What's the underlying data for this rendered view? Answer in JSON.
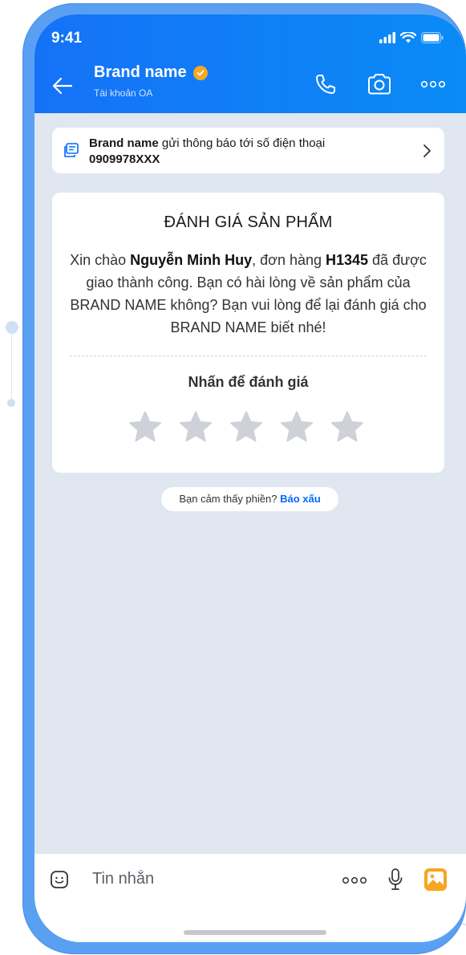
{
  "status_bar": {
    "time": "9:41"
  },
  "header": {
    "brand_name": "Brand name",
    "subtitle": "Tài khoản OA",
    "colors": {
      "gradient_start": "#1572f7",
      "gradient_end": "#0a8bf6",
      "verified": "#f6a823"
    }
  },
  "notice": {
    "brand": "Brand name",
    "text": " gửi thông báo tới số điện thoại",
    "phone": "0909978XXX"
  },
  "card": {
    "title": "ĐÁNH GIÁ SẢN PHẨM",
    "greeting": "Xin chào ",
    "customer_name": "Nguyễn Minh Huy",
    "order_prefix": ", đơn hàng ",
    "order_id": "H1345",
    "body_rest": " đã được giao thành công. Bạn có hài lòng về sản phẩm của BRAND NAME không? Bạn vui lòng để lại đánh giá cho BRAND NAME biết nhé!",
    "rate_label": "Nhấn để đánh giá",
    "rating": {
      "value": 0,
      "max": 5
    }
  },
  "report": {
    "text": "Bạn cảm thấy phiền? ",
    "link": "Báo xấu"
  },
  "input_bar": {
    "placeholder": "Tin nhắn"
  },
  "icons": [
    "back-arrow-icon",
    "verified-icon",
    "phone-icon",
    "camera-icon",
    "more-icon",
    "notice-icon",
    "chevron-right-icon",
    "star-icon",
    "emoji-icon",
    "mic-icon",
    "image-icon"
  ],
  "colors": {
    "screen_bg": "#e0e7f0",
    "frame": "#5aa0f2",
    "star": "#cfd1d9",
    "link": "#0068ff"
  }
}
